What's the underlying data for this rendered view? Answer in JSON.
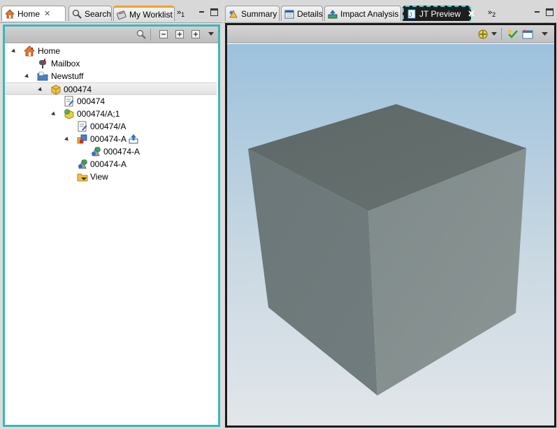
{
  "left": {
    "tabs": [
      {
        "label": "Home",
        "icon": "home-icon",
        "active": true,
        "closable": true
      },
      {
        "label": "Search",
        "icon": "search-icon",
        "active": false
      },
      {
        "label": "My Worklist",
        "icon": "worklist-icon",
        "active": false
      }
    ],
    "overflow_count": "1",
    "tree": [
      {
        "label": "Home",
        "icon": "home-icon",
        "level": 0,
        "expanded": true
      },
      {
        "label": "Mailbox",
        "icon": "mailbox-icon",
        "level": 1
      },
      {
        "label": "Newstuff",
        "icon": "folder-newstuff-icon",
        "level": 1,
        "expanded": true
      },
      {
        "label": "000474",
        "icon": "item-icon",
        "level": 2,
        "expanded": true,
        "selected": true
      },
      {
        "label": "000474",
        "icon": "item-master-icon",
        "level": 3
      },
      {
        "label": "000474/A;1",
        "icon": "item-revision-icon",
        "level": 3,
        "expanded": true
      },
      {
        "label": "000474/A",
        "icon": "revision-master-icon",
        "level": 4
      },
      {
        "label": "000474-A",
        "icon": "bom-view-icon",
        "level": 4,
        "expanded": true,
        "badge": "export-badge-icon"
      },
      {
        "label": "000474-A",
        "icon": "dataset-jt-icon",
        "level": 5
      },
      {
        "label": "000474-A",
        "icon": "dataset-icon",
        "level": 4
      },
      {
        "label": "View",
        "icon": "view-folder-icon",
        "level": 4
      }
    ]
  },
  "right": {
    "tabs": [
      {
        "label": "Summary",
        "icon": "summary-icon"
      },
      {
        "label": "Details",
        "icon": "details-icon"
      },
      {
        "label": "Impact Analysis",
        "icon": "impact-analysis-icon"
      },
      {
        "label": "JT Preview",
        "icon": "jt-preview-icon",
        "active": true,
        "closable": true
      }
    ],
    "overflow_count": "2"
  },
  "colors": {
    "focus_border": "#3ab8b4",
    "viewer_bg_top": "#9dc1dd",
    "viewer_bg_bottom": "#e2e6ea",
    "cube_top": "#5f6b6c",
    "cube_left": "#6e7a7b",
    "cube_right": "#86918f"
  }
}
